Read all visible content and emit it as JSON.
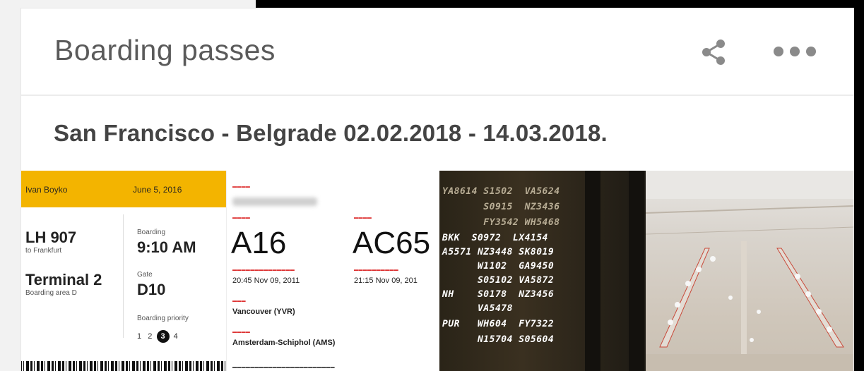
{
  "header": {
    "title": "Boarding passes",
    "share_icon": "share-icon",
    "more_icon": "more-horizontal-icon"
  },
  "trip": {
    "title": "San Francisco - Belgrade 02.02.2018 - 14.03.2018."
  },
  "thumbnails": {
    "pass1": {
      "passenger": "Ivan Boyko",
      "date": "June 5, 2016",
      "flight": "LH 907",
      "destination": "to Frankfurt",
      "boarding_label": "Boarding",
      "boarding_time": "9:10 AM",
      "terminal": "Terminal 2",
      "boarding_area": "Boarding area D",
      "gate_label": "Gate",
      "gate": "D10",
      "priority_label": "Boarding priority",
      "priority_numbers": [
        "1",
        "2",
        "3",
        "4"
      ],
      "priority_selected": "3"
    },
    "pass2": {
      "gate": "A16",
      "flight": "AC65",
      "boarding_time": "20:45 Nov 09, 2011",
      "departure_time": "21:15 Nov 09, 201",
      "from_city": "Vancouver (YVR)",
      "to_city": "Amsterdam-Schiphol (AMS)"
    },
    "board_rows": [
      "BKK  S0972  LX4154",
      "A5571 NZ3448 SK8019",
      "      W1102  GA9450",
      "      S05102 VA5872",
      "NH    S0178  NZ3456",
      "      VA5478",
      "PUR   WH604  FY7322",
      "      N15704 S05604"
    ],
    "board_top_rows": [
      "YA8614 S1502  VA5624",
      "       S0915  NZ3436",
      "       FY3542 WH5468"
    ],
    "colors": {
      "pass_bar": "#f3b400",
      "pass_label_red": "#dd3333"
    }
  }
}
